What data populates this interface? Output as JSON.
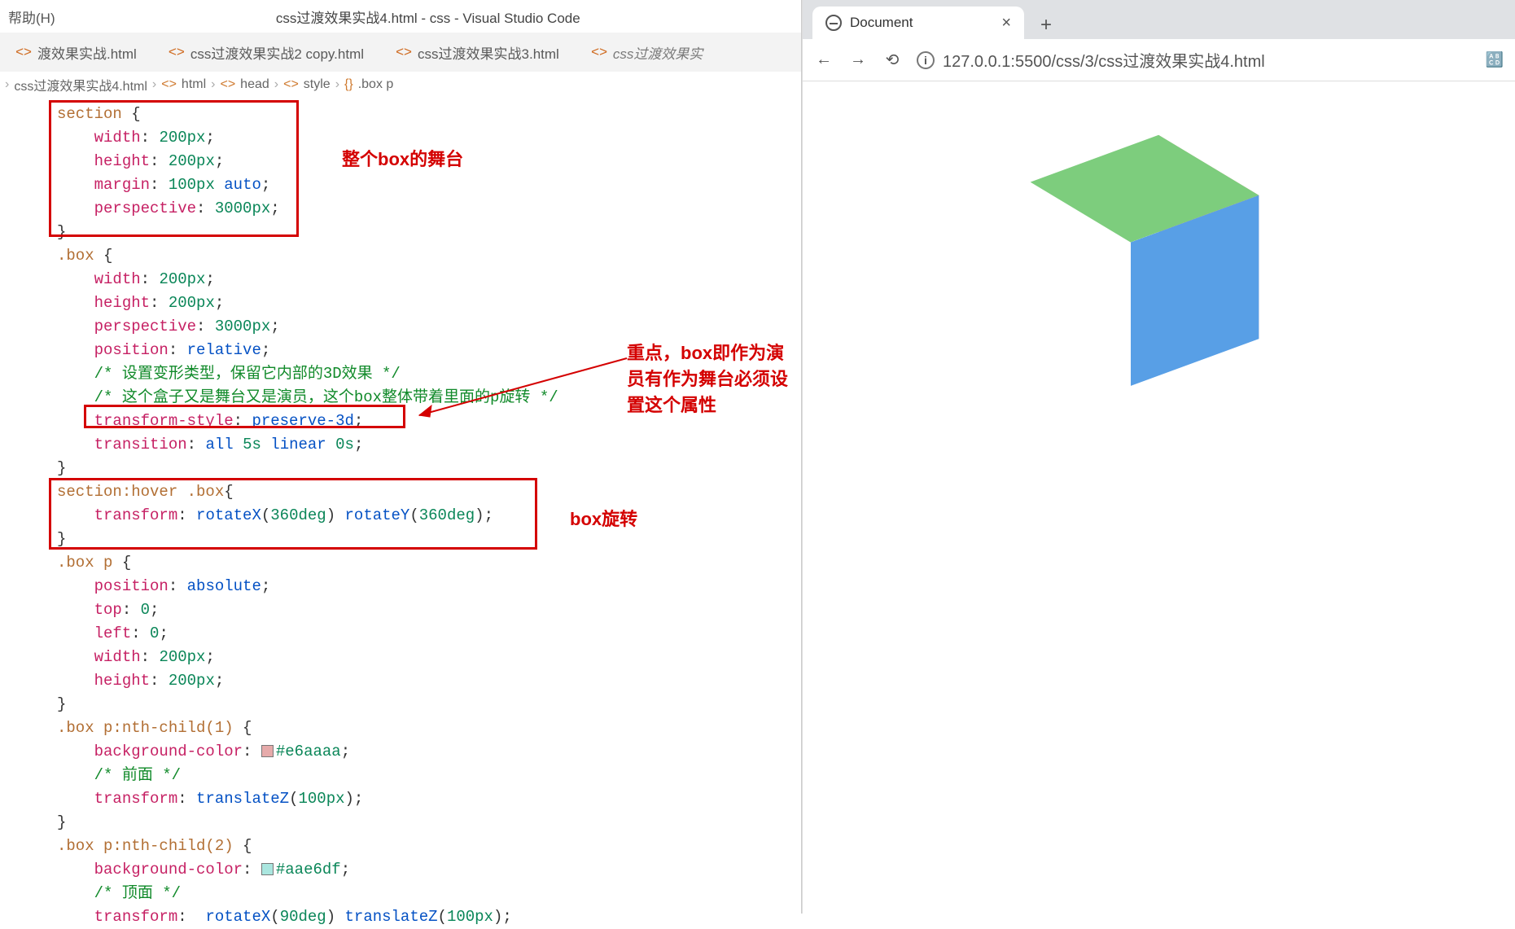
{
  "vscode": {
    "menu": "帮助(H)",
    "title": "css过渡效果实战4.html - css - Visual Studio Code",
    "tabs": [
      "渡效果实战.html",
      "css过渡效果实战2 copy.html",
      "css过渡效果实战3.html",
      "css过渡效果实"
    ],
    "crumbs": [
      "css过渡效果实战4.html",
      "html",
      "head",
      "style",
      ".box p"
    ]
  },
  "annotations": {
    "a1": "整个box的舞台",
    "a2": "重点，box即作为演员有作为舞台必须设置这个属性",
    "a3": "box旋转"
  },
  "chrome": {
    "tab": "Document",
    "url": "127.0.0.1:5500/css/3/css过渡效果实战4.html"
  },
  "code": {
    "l01s": "section",
    "l01": " {",
    "l02p": "width",
    "l02v": "200px",
    "l03p": "height",
    "l03v": "200px",
    "l04p": "margin",
    "l04v1": "100px",
    "l04v2": " auto",
    "l05p": "perspective",
    "l05v": "3000px",
    "l06": "}",
    "l07s": ".box",
    "l07": " {",
    "l08p": "width",
    "l08v": "200px",
    "l09p": "height",
    "l09v": "200px",
    "l10p": "perspective",
    "l10v": "3000px",
    "l11p": "position",
    "l11v": "relative",
    "l12c": "/* 设置变形类型，保留它内部的3D效果 */",
    "l13c": "/* 这个盒子又是舞台又是演员，这个box整体带着里面的p旋转 */",
    "l14p": "transform-style",
    "l14v": "preserve-3d",
    "l15p": "transition",
    "l15v1": "all",
    "l15v2": "5s",
    "l15v3": "linear",
    "l15v4": "0s",
    "l16": "}",
    "l17s": "section:hover .box",
    "l17": "{",
    "l18p": "transform",
    "l18v1": "rotateX",
    "l18a1": "360deg",
    "l18v2": "rotateY",
    "l18a2": "360deg",
    "l19": "}",
    "l20s": ".box p",
    "l20": " {",
    "l21p": "position",
    "l21v": "absolute",
    "l22p": "top",
    "l22v": "0",
    "l23p": "left",
    "l23v": "0",
    "l24p": "width",
    "l24v": "200px",
    "l25p": "height",
    "l25v": "200px",
    "l26": "}",
    "l27s": ".box p:nth-child(1)",
    "l27": " {",
    "l28p": "background-color",
    "l28h": "#e6aaaa",
    "l29c": "/* 前面 */",
    "l30p": "transform",
    "l30v": "translateZ",
    "l30a": "100px",
    "l31": "}",
    "l32s": ".box p:nth-child(2)",
    "l32": " {",
    "l33p": "background-color",
    "l33h": "#aae6df",
    "l34c": "/* 顶面 */",
    "l35p": "transform",
    "l35v1": "rotateX",
    "l35a1": "90deg",
    "l35v2": "translateZ",
    "l35a2": "100px"
  }
}
